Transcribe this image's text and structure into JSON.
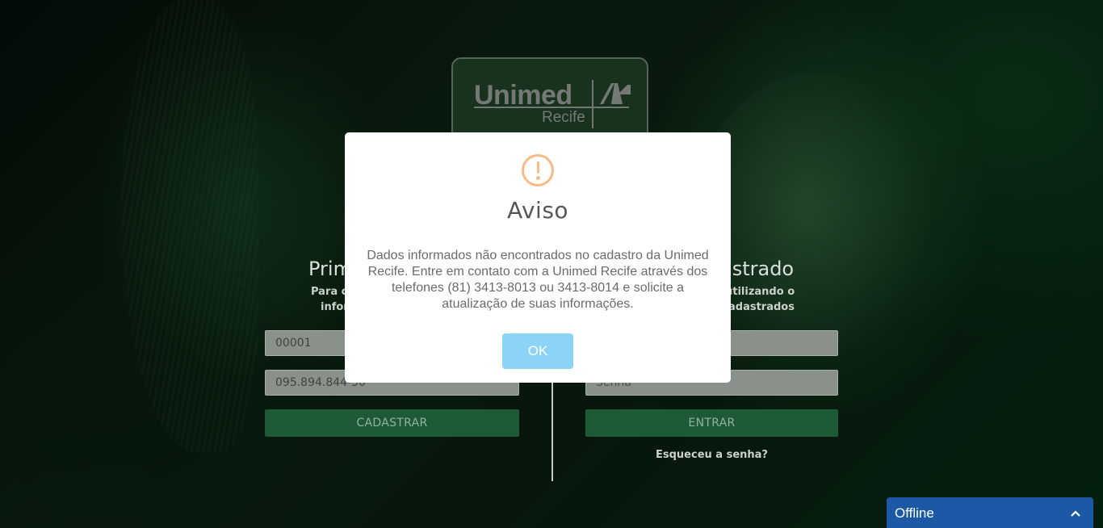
{
  "logo": {
    "brand": "Unimed",
    "city": "Recife"
  },
  "left_panel": {
    "heading": "Prim",
    "sub_line1": "Para c",
    "sub_line2": "infor",
    "card_value": "00001",
    "cpf_value": "095.894.844-50",
    "button_label": "CADASTRAR"
  },
  "right_panel": {
    "heading": "astrado",
    "sub_line1": "utilizando o",
    "sub_line2": "adastrados",
    "password_placeholder": "Senha",
    "button_label": "ENTRAR",
    "forgot_link": "Esqueceu a senha?"
  },
  "modal": {
    "icon": "warning-icon",
    "title": "Aviso",
    "message": "Dados informados não encontrados no cadastro da Unimed Recife. Entre em contato com a Unimed Recife através dos telefones (81) 3413-8013 ou 3413-8014 e solicite a atualização de suas informações.",
    "ok_label": "OK",
    "accent_color": "#f8bb86",
    "button_color": "#8cd4f5"
  },
  "chat_widget": {
    "label": "Offline",
    "toggle_icon": "chevron-up-icon"
  }
}
